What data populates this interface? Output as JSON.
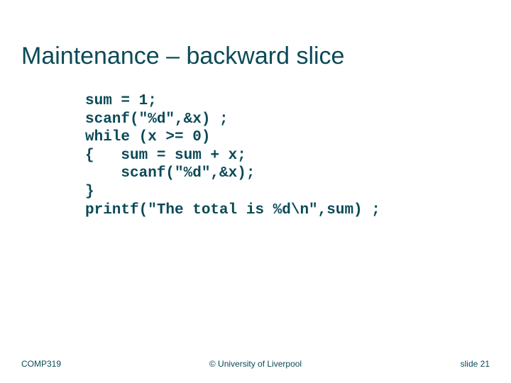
{
  "title": "Maintenance – backward slice",
  "code": "sum = 1;\nscanf(\"%d\",&x) ;\nwhile (x >= 0)\n{   sum = sum + x;\n    scanf(\"%d\",&x);\n}\nprintf(\"The total is %d\\n\",sum) ;",
  "footer": {
    "left": "COMP319",
    "center": "© University of Liverpool",
    "right": "slide  21"
  }
}
